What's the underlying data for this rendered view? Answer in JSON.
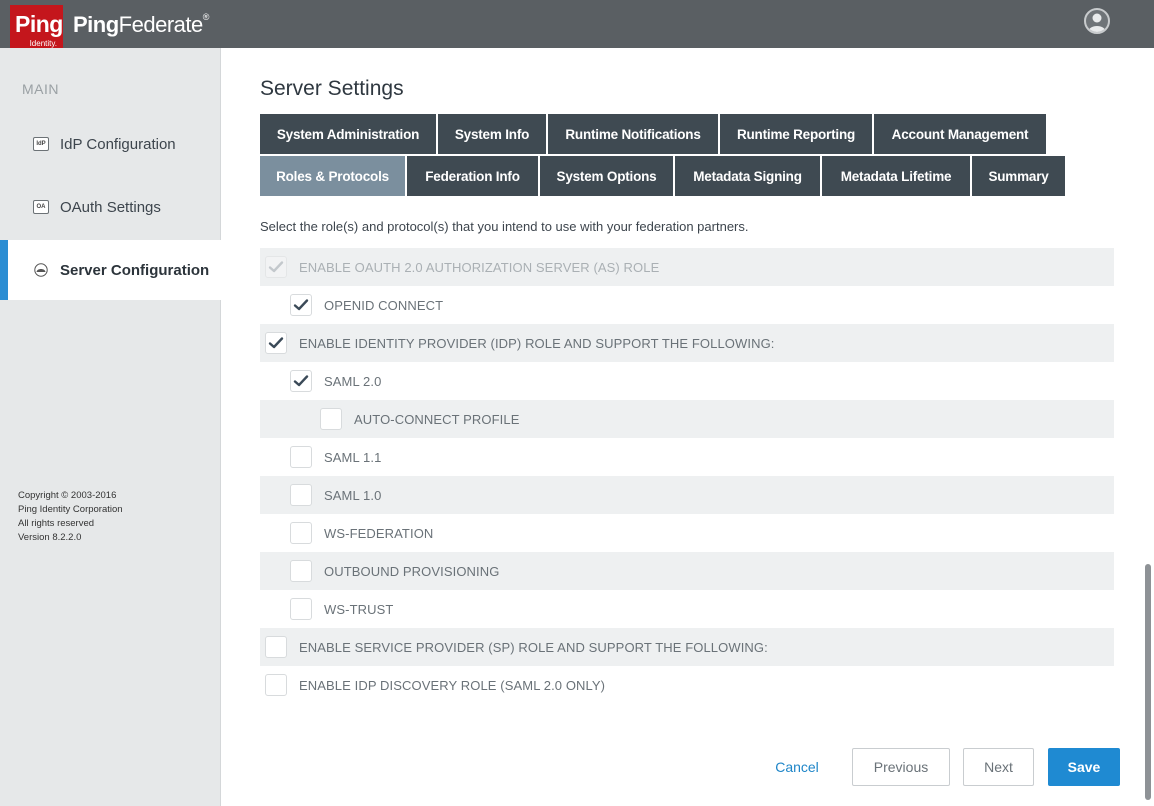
{
  "header": {
    "logo_word": "Ping",
    "logo_sub": "Identity.",
    "product_bold": "Ping",
    "product_rest": "Federate",
    "product_reg": "®"
  },
  "sidebar": {
    "section": "MAIN",
    "items": [
      {
        "label": "IdP Configuration",
        "icon_text": "IdP"
      },
      {
        "label": "OAuth Settings",
        "icon_text": "OA"
      },
      {
        "label": "Server Configuration",
        "icon_text": ""
      }
    ],
    "copyright": [
      "Copyright © 2003-2016",
      "Ping Identity Corporation",
      "All rights reserved",
      "Version 8.2.2.0"
    ]
  },
  "page": {
    "title": "Server Settings",
    "instruction": "Select the role(s) and protocol(s) that you intend to use with your federation partners."
  },
  "tabs_row1": [
    "System Administration",
    "System Info",
    "Runtime Notifications",
    "Runtime Reporting",
    "Account Management"
  ],
  "tabs_row2": [
    "Roles & Protocols",
    "Federation Info",
    "System Options",
    "Metadata Signing",
    "Metadata Lifetime",
    "Summary"
  ],
  "options": [
    {
      "label": "ENABLE OAUTH 2.0 AUTHORIZATION SERVER (AS) ROLE",
      "checked": true,
      "disabled": true
    },
    {
      "label": "OPENID CONNECT",
      "checked": true,
      "disabled": false
    },
    {
      "label": "ENABLE IDENTITY PROVIDER (IDP) ROLE AND SUPPORT THE FOLLOWING:",
      "checked": true,
      "disabled": false
    },
    {
      "label": "SAML 2.0",
      "checked": true,
      "disabled": false
    },
    {
      "label": "AUTO-CONNECT PROFILE",
      "checked": false,
      "disabled": false
    },
    {
      "label": "SAML 1.1",
      "checked": false,
      "disabled": false
    },
    {
      "label": "SAML 1.0",
      "checked": false,
      "disabled": false
    },
    {
      "label": "WS-FEDERATION",
      "checked": false,
      "disabled": false
    },
    {
      "label": "OUTBOUND PROVISIONING",
      "checked": false,
      "disabled": false
    },
    {
      "label": "WS-TRUST",
      "checked": false,
      "disabled": false
    },
    {
      "label": "ENABLE SERVICE PROVIDER (SP) ROLE AND SUPPORT THE FOLLOWING:",
      "checked": false,
      "disabled": false
    },
    {
      "label": "ENABLE IDP DISCOVERY ROLE (SAML 2.0 ONLY)",
      "checked": false,
      "disabled": false
    }
  ],
  "buttons": {
    "cancel": "Cancel",
    "previous": "Previous",
    "next": "Next",
    "save": "Save"
  },
  "colors": {
    "header_bg": "#5a5f63",
    "brand_red": "#c4161c",
    "tab_bg": "#3f4a52",
    "tab_active_bg": "#7b8f9e",
    "accent_blue": "#1f8ad2"
  }
}
